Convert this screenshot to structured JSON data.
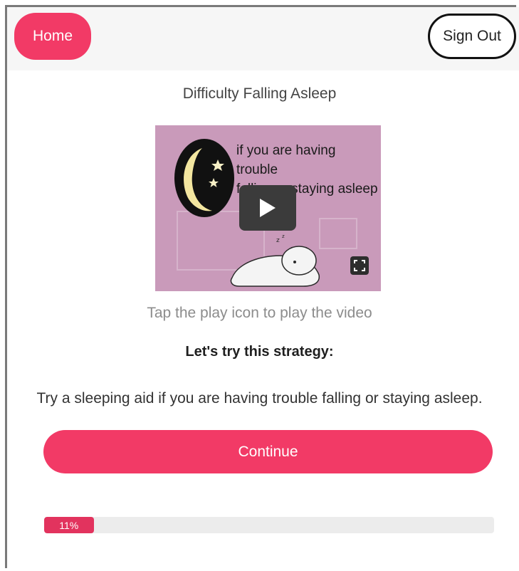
{
  "header": {
    "home_label": "Home",
    "signout_label": "Sign Out"
  },
  "page": {
    "title": "Difficulty Falling Asleep",
    "video": {
      "caption_line1": "if you are having trouble",
      "caption_line2": "falling or staying asleep",
      "icons": [
        "moon-icon",
        "star-icon",
        "play-icon",
        "fullscreen-icon",
        "sleeping-person-illustration"
      ]
    },
    "hint": "Tap the play icon to play the video",
    "strategy_heading": "Let's try this strategy:",
    "strategy_text": "Try a sleeping aid if you are having trouble falling or staying asleep.",
    "continue_label": "Continue"
  },
  "progress": {
    "value": 0.11,
    "label": "11%"
  },
  "colors": {
    "accent": "#f23a66",
    "video_bg": "#c99aba",
    "progress_track": "#ececec"
  }
}
